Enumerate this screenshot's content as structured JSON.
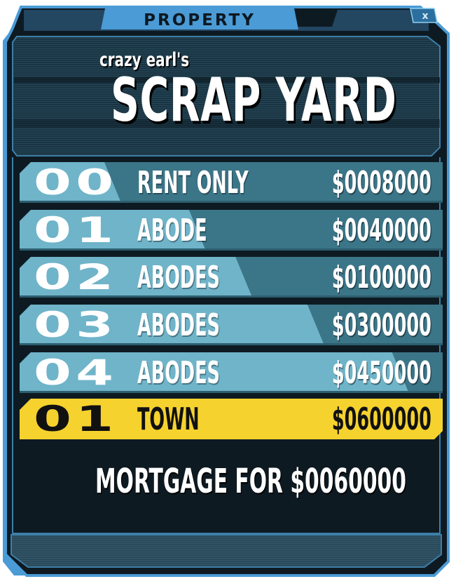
{
  "header": {
    "title": "PROPERTY",
    "close_label": "x"
  },
  "property": {
    "subtitle": "crazy earl's",
    "name": "SCRAP YARD"
  },
  "rent_table": [
    {
      "count": "00",
      "label": "RENT ONLY",
      "price": "$0008000",
      "selected": false,
      "divide": 0.24
    },
    {
      "count": "01",
      "label": "ABODE",
      "price": "$0040000",
      "selected": false,
      "divide": 0.44
    },
    {
      "count": "02",
      "label": "ABODES",
      "price": "$0100000",
      "selected": false,
      "divide": 0.55
    },
    {
      "count": "03",
      "label": "ABODES",
      "price": "$0300000",
      "selected": false,
      "divide": 0.72
    },
    {
      "count": "04",
      "label": "ABODES",
      "price": "$0450000",
      "selected": false,
      "divide": 0.92
    },
    {
      "count": "01",
      "label": "TOWN",
      "price": "$0600000",
      "selected": true,
      "divide": 1.0
    }
  ],
  "footer": {
    "mortgage_text": "MORTGAGE FOR $0060000"
  },
  "colors": {
    "frame_blue": "#4a9bd6",
    "panel_dark": "#0e1a22",
    "row_light": "#6fb4c9",
    "row_dark": "#3b7588",
    "selected_yellow": "#f5d22e"
  }
}
